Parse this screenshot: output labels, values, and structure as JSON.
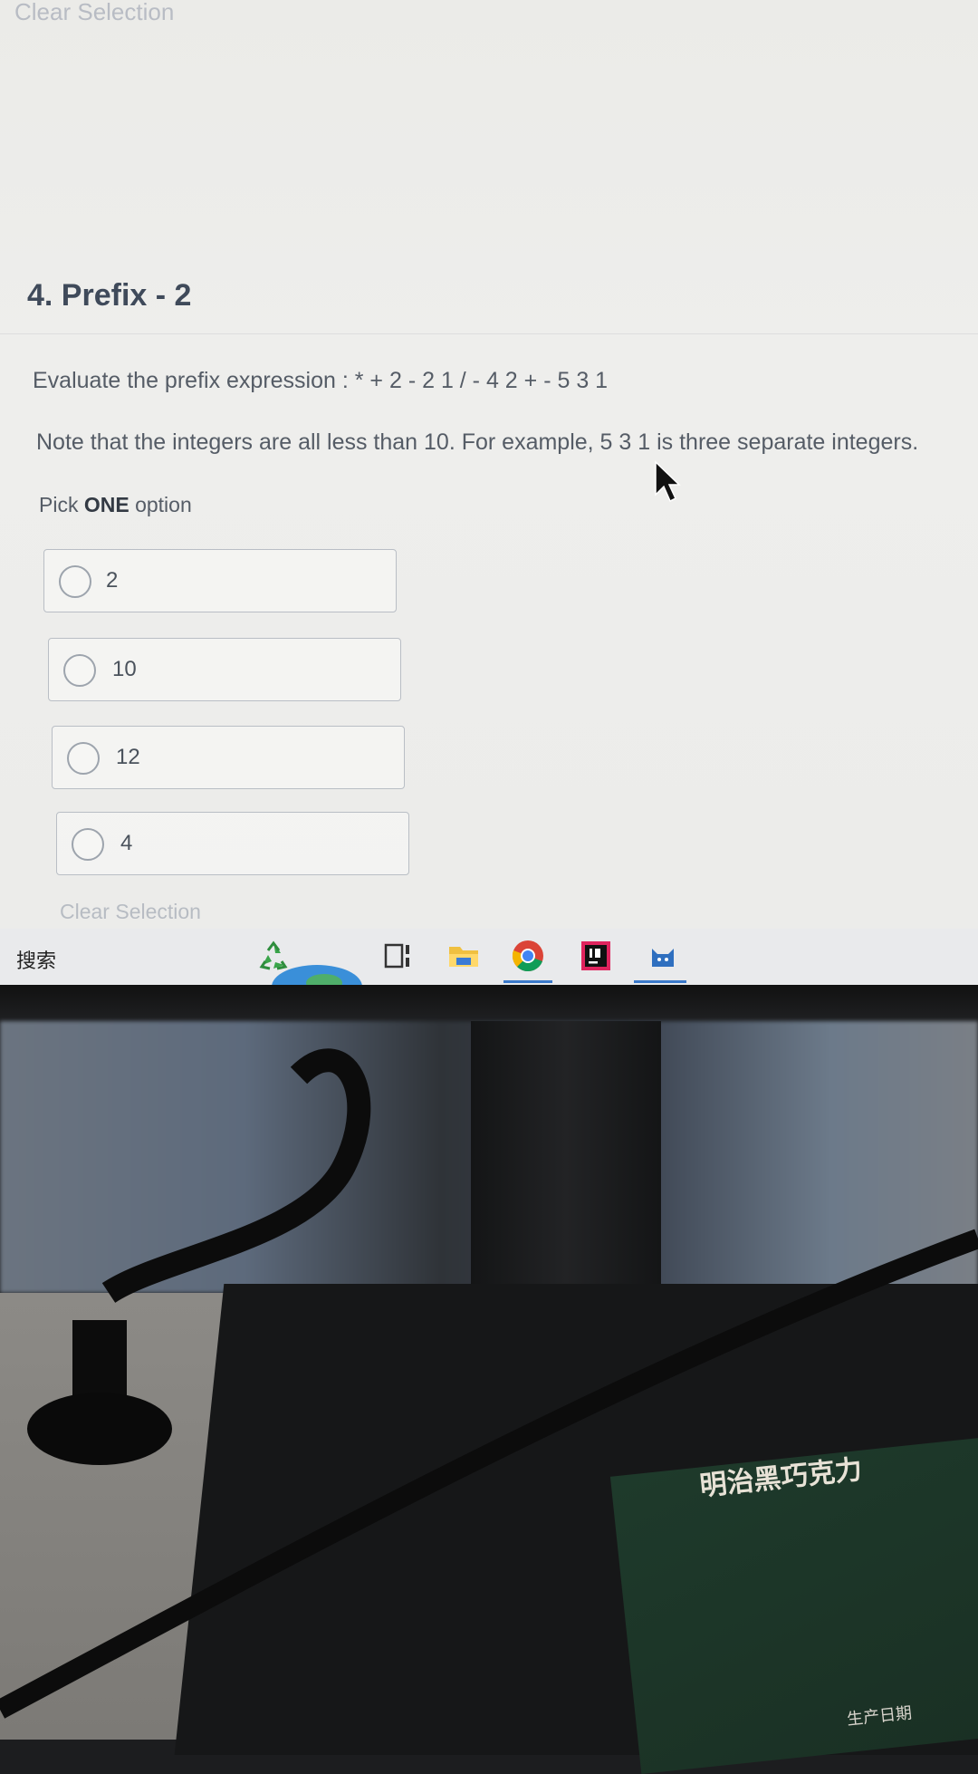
{
  "page": {
    "clear_top_label": "Clear Selection",
    "question_title": "4. Prefix - 2",
    "question_text": "Evaluate the prefix expression : * + 2 - 2 1 / - 4 2 + - 5 3 1",
    "note_text": "Note that the integers are all less than 10.  For example, 5 3 1 is three separate integers.",
    "pick_prefix": "Pick ",
    "pick_bold": "ONE",
    "pick_suffix": " option",
    "options": [
      {
        "label": "2",
        "selected": false
      },
      {
        "label": "10",
        "selected": false
      },
      {
        "label": "12",
        "selected": false
      },
      {
        "label": "4",
        "selected": false
      }
    ],
    "clear_bottom_label": "Clear Selection"
  },
  "taskbar": {
    "search_label": "搜索",
    "icons": [
      "recycle-icon",
      "task-view-icon",
      "file-explorer-icon",
      "chrome-icon",
      "intellij-icon",
      "app-cat-icon"
    ]
  },
  "scene": {
    "package_title": "明治黑巧克力",
    "package_date_label": "生产日期"
  }
}
